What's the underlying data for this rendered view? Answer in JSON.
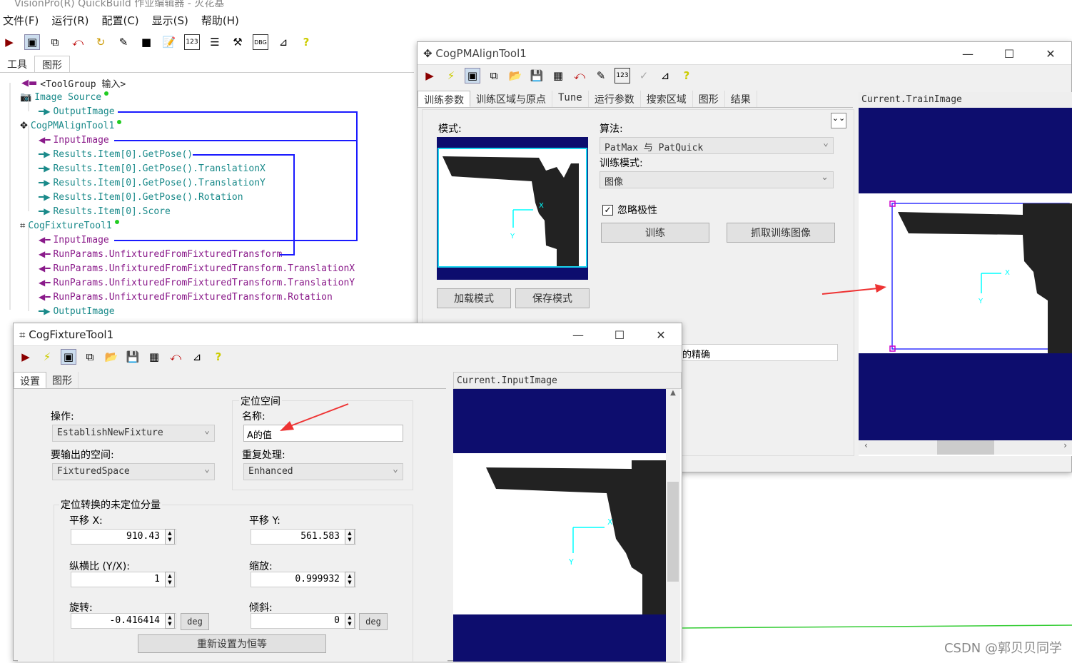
{
  "app": {
    "title": "VisionPro(R) QuickBuild 作业编辑器 - 灭花基",
    "menu": [
      "文件(F)",
      "运行(R)",
      "配置(C)",
      "显示(S)",
      "帮助(H)"
    ],
    "tabs": [
      "工具",
      "图形"
    ]
  },
  "tree": {
    "items": [
      {
        "label": "<ToolGroup 输入>",
        "kind": "plain"
      },
      {
        "label": "Image Source",
        "kind": "out"
      },
      {
        "label": "OutputImage",
        "kind": "out"
      },
      {
        "label": "CogPMAlignTool1",
        "kind": "out"
      },
      {
        "label": "InputImage",
        "kind": "in"
      },
      {
        "label": "Results.Item[0].GetPose()",
        "kind": "out"
      },
      {
        "label": "Results.Item[0].GetPose().TranslationX",
        "kind": "out"
      },
      {
        "label": "Results.Item[0].GetPose().TranslationY",
        "kind": "out"
      },
      {
        "label": "Results.Item[0].GetPose().Rotation",
        "kind": "out"
      },
      {
        "label": "Results.Item[0].Score",
        "kind": "out"
      },
      {
        "label": "CogFixtureTool1",
        "kind": "out"
      },
      {
        "label": "InputImage",
        "kind": "in"
      },
      {
        "label": "RunParams.UnfixturedFromFixturedTransform",
        "kind": "in"
      },
      {
        "label": "RunParams.UnfixturedFromFixturedTransform.TranslationX",
        "kind": "in"
      },
      {
        "label": "RunParams.UnfixturedFromFixturedTransform.TranslationY",
        "kind": "in"
      },
      {
        "label": "RunParams.UnfixturedFromFixturedTransform.Rotation",
        "kind": "in"
      },
      {
        "label": "OutputImage",
        "kind": "out"
      }
    ]
  },
  "pm": {
    "title": "CogPMAlignTool1",
    "tabs": [
      "训练参数",
      "训练区域与原点",
      "Tune",
      "运行参数",
      "搜索区域",
      "图形",
      "结果"
    ],
    "pattern_label": "模式:",
    "algo_label": "算法:",
    "algo_value": "PatMax 与 PatQuick",
    "train_mode_label": "训练模式:",
    "train_mode_value": "图像",
    "ignore_polarity": "忽略极性",
    "train_btn": "训练",
    "grab_btn": "抓取训练图像",
    "load_btn": "加载模式",
    "save_btn": "保存模式",
    "image_title": "Current.TrainImage",
    "partial_text": "的精确"
  },
  "fx": {
    "title": "CogFixtureTool1",
    "tabs": [
      "设置",
      "图形"
    ],
    "op_label": "操作:",
    "op_value": "EstablishNewFixture",
    "out_space_label": "要输出的空间:",
    "out_space_value": "FixturedSpace",
    "group_space": "定位空间",
    "name_label": "名称:",
    "name_value": "A的值",
    "dup_label": "重复处理:",
    "dup_value": "Enhanced",
    "group_transform": "定位转换的未定位分量",
    "tx_label": "平移 X:",
    "tx_value": "910.43",
    "ty_label": "平移 Y:",
    "ty_value": "561.583",
    "aspect_label": "纵横比 (Y/X):",
    "aspect_value": "1",
    "scale_label": "缩放:",
    "scale_value": "0.999932",
    "rot_label": "旋转:",
    "rot_value": "-0.416414",
    "skew_label": "倾斜:",
    "skew_value": "0",
    "deg": "deg",
    "reset_btn": "重新设置为恒等",
    "image_title": "Current.InputImage"
  },
  "watermark": "CSDN @郭贝贝同学"
}
